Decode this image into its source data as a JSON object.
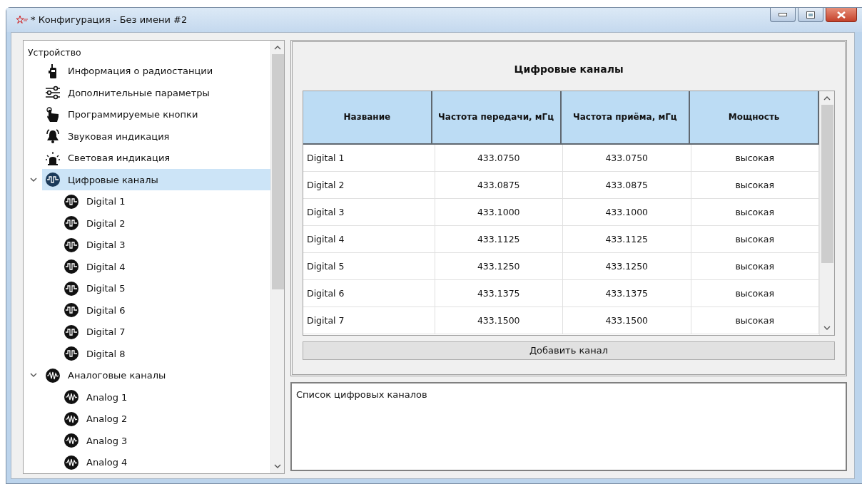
{
  "window": {
    "title": "* Конфигурация - Без имени #2"
  },
  "tree": {
    "label": "Устройство",
    "children": [
      {
        "label": "Информация о радиостанции",
        "kind": "radio",
        "selected": false
      },
      {
        "label": "Дополнительные параметры",
        "kind": "sliders",
        "selected": false
      },
      {
        "label": "Программируемые кнопки",
        "kind": "hand",
        "selected": false
      },
      {
        "label": "Звуковая индикация",
        "kind": "bell",
        "selected": false
      },
      {
        "label": "Световая индикация",
        "kind": "light",
        "selected": false
      },
      {
        "label": "Цифровые каналы",
        "kind": "digital",
        "selected": true,
        "expanded": true,
        "children": [
          {
            "label": "Digital 1",
            "kind": "digital",
            "selected": false
          },
          {
            "label": "Digital 2",
            "kind": "digital",
            "selected": false
          },
          {
            "label": "Digital 3",
            "kind": "digital",
            "selected": false
          },
          {
            "label": "Digital 4",
            "kind": "digital",
            "selected": false
          },
          {
            "label": "Digital 5",
            "kind": "digital",
            "selected": false
          },
          {
            "label": "Digital 6",
            "kind": "digital",
            "selected": false
          },
          {
            "label": "Digital 7",
            "kind": "digital",
            "selected": false
          },
          {
            "label": "Digital 8",
            "kind": "digital",
            "selected": false
          }
        ]
      },
      {
        "label": "Аналоговые каналы",
        "kind": "analog",
        "selected": false,
        "expanded": true,
        "children": [
          {
            "label": "Analog 1",
            "kind": "analog",
            "selected": false
          },
          {
            "label": "Analog 2",
            "kind": "analog",
            "selected": false
          },
          {
            "label": "Analog 3",
            "kind": "analog",
            "selected": false
          },
          {
            "label": "Analog 4",
            "kind": "analog",
            "selected": false
          }
        ]
      }
    ]
  },
  "panel": {
    "title": "Цифровые каналы",
    "table": {
      "columns": [
        "Название",
        "Частота передачи, мГц",
        "Частота приёма, мГц",
        "Мощность"
      ],
      "rows": [
        [
          "Digital 1",
          "433.0750",
          "433.0750",
          "высокая"
        ],
        [
          "Digital 2",
          "433.0875",
          "433.0875",
          "высокая"
        ],
        [
          "Digital 3",
          "433.1000",
          "433.1000",
          "высокая"
        ],
        [
          "Digital 4",
          "433.1125",
          "433.1125",
          "высокая"
        ],
        [
          "Digital 5",
          "433.1250",
          "433.1250",
          "высокая"
        ],
        [
          "Digital 6",
          "433.1375",
          "433.1375",
          "высокая"
        ],
        [
          "Digital 7",
          "433.1500",
          "433.1500",
          "высокая"
        ]
      ]
    },
    "add_button": "Добавить канал",
    "description": "Список цифровых каналов"
  }
}
